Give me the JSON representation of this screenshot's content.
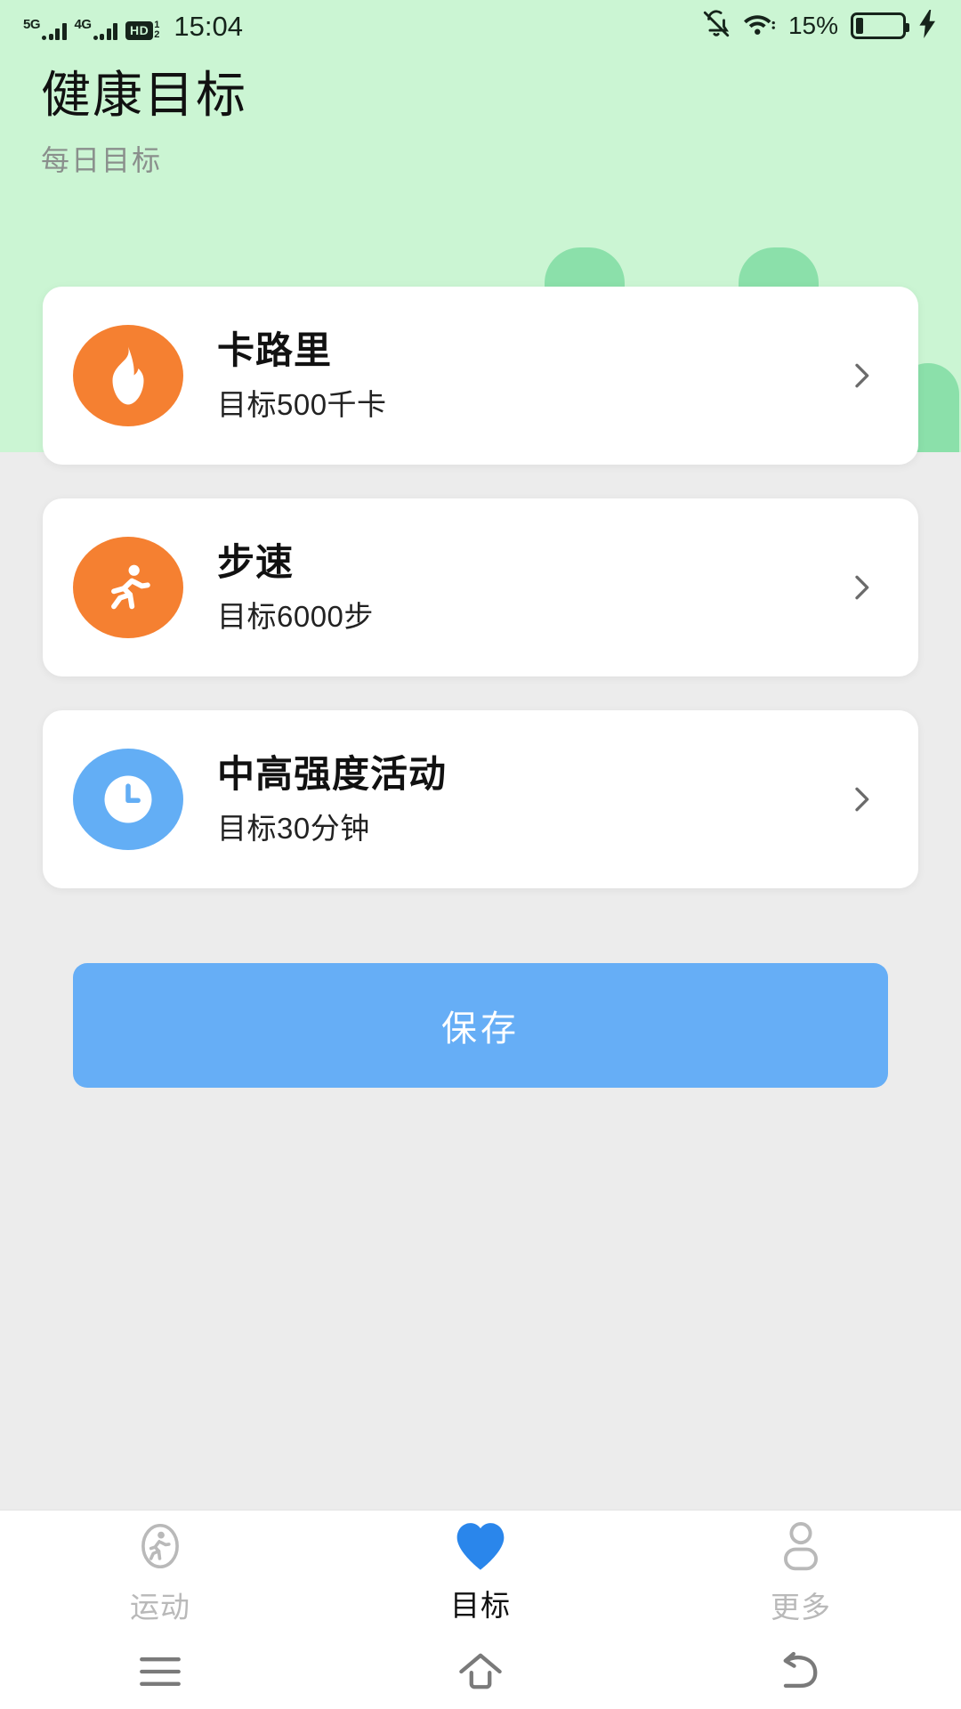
{
  "statusbar": {
    "net1_label": "5G",
    "net2_label": "4G",
    "hd_label": "HD",
    "hd_sup": "1",
    "hd_sub": "2",
    "time": "15:04",
    "battery_percent": "15%",
    "icons": [
      "bell-off-icon",
      "wifi-icon",
      "battery-icon",
      "charging-bolt-icon"
    ]
  },
  "header": {
    "title": "健康目标",
    "subtitle": "每日目标",
    "bg_color": "#CBF5D3",
    "deco_color": "#8BE0AA"
  },
  "goals": [
    {
      "title": "卡路里",
      "subtitle": "目标500千卡",
      "icon": "flame-icon",
      "icon_color": "#F58031",
      "chevron": "chevron-right-icon"
    },
    {
      "title": "步速",
      "subtitle": "目标6000步",
      "icon": "running-person-icon",
      "icon_color": "#F58031",
      "chevron": "chevron-right-icon"
    },
    {
      "title": "中高强度活动",
      "subtitle": "目标30分钟",
      "icon": "clock-icon",
      "icon_color": "#63AEF5",
      "chevron": "chevron-right-icon"
    }
  ],
  "save_button": {
    "label": "保存",
    "color": "#66AEF6"
  },
  "bottom_nav": {
    "items": [
      {
        "label": "运动",
        "icon": "walking-person-circle-icon",
        "active": false
      },
      {
        "label": "目标",
        "icon": "heart-icon",
        "active": true
      },
      {
        "label": "更多",
        "icon": "user-icon",
        "active": false
      }
    ],
    "active_color": "#2A86EB",
    "inactive_color": "#B9B9B9"
  },
  "system_nav": {
    "items": [
      "menu-icon",
      "home-icon",
      "back-icon"
    ]
  }
}
